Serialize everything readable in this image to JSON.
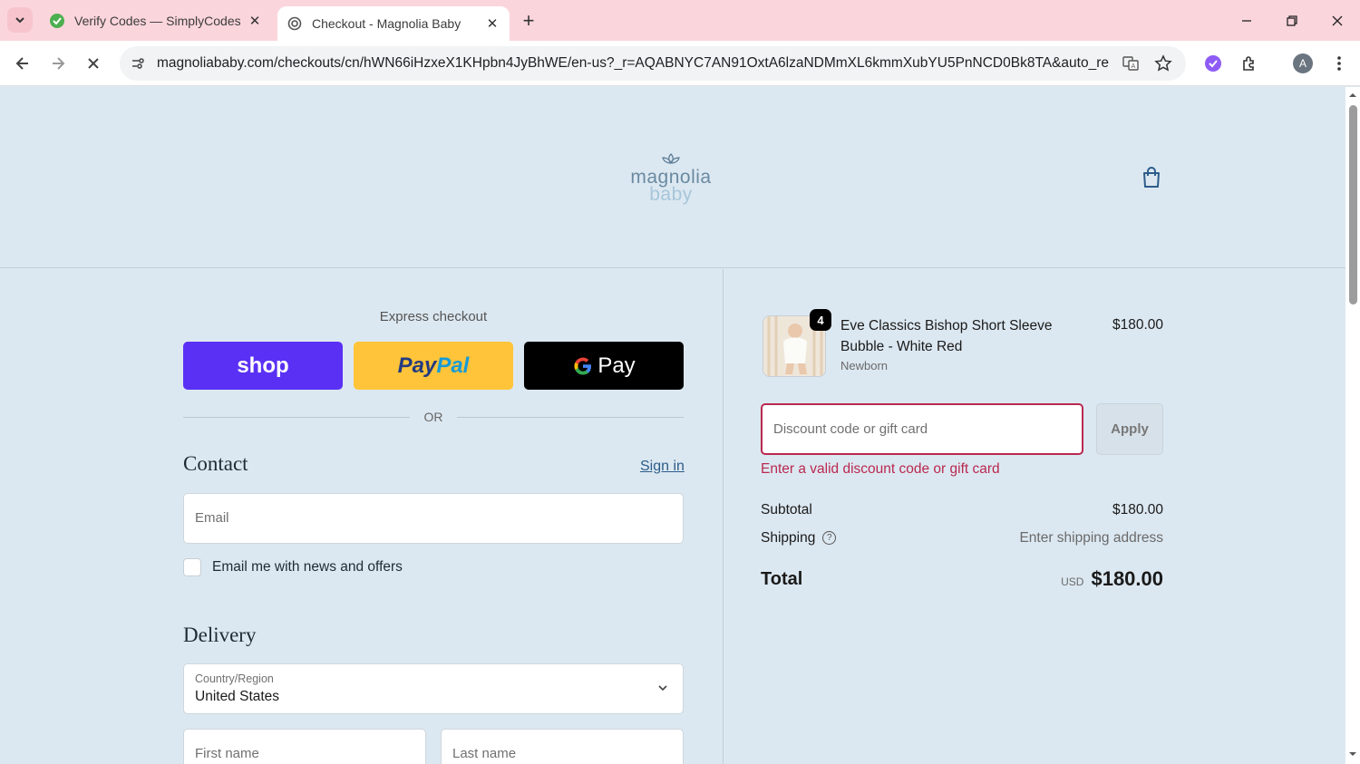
{
  "browser": {
    "tabs": [
      {
        "title": "Verify Codes — SimplyCodes",
        "active": false
      },
      {
        "title": "Checkout - Magnolia Baby",
        "active": true
      }
    ],
    "url": "magnoliababy.com/checkouts/cn/hWN66iHzxeX1KHpbn4JyBhWE/en-us?_r=AQABNYC7AN91OxtA6lzaNDMmXL6kmmXubYU5PnNCD0Bk8TA&auto_redir...",
    "profile_initial": "A"
  },
  "store": {
    "logo_line1": "magnolia",
    "logo_line2": "baby"
  },
  "express": {
    "label": "Express checkout",
    "shop_label": "shop",
    "paypal_part1": "Pay",
    "paypal_part2": "Pal",
    "gpay_label": "Pay",
    "or_label": "OR"
  },
  "contact": {
    "title": "Contact",
    "signin_label": "Sign in",
    "email_placeholder": "Email",
    "newsletter_label": "Email me with news and offers"
  },
  "delivery": {
    "title": "Delivery",
    "country_label": "Country/Region",
    "country_value": "United States",
    "first_name_placeholder": "First name",
    "last_name_placeholder": "Last name"
  },
  "order": {
    "item": {
      "quantity": "4",
      "name": "Eve Classics Bishop Short Sleeve Bubble - White Red",
      "variant": "Newborn",
      "price": "$180.00"
    },
    "discount_placeholder": "Discount code or gift card",
    "apply_label": "Apply",
    "discount_error": "Enter a valid discount code or gift card",
    "subtotal_label": "Subtotal",
    "subtotal_value": "$180.00",
    "shipping_label": "Shipping",
    "shipping_value": "Enter shipping address",
    "total_label": "Total",
    "total_currency": "USD",
    "total_value": "$180.00"
  },
  "colors": {
    "page_bg": "#dce8f1",
    "tabbar_bg": "#fbd5dc",
    "error": "#b9294f",
    "shop_pay": "#5a31f4",
    "paypal": "#ffc439"
  }
}
